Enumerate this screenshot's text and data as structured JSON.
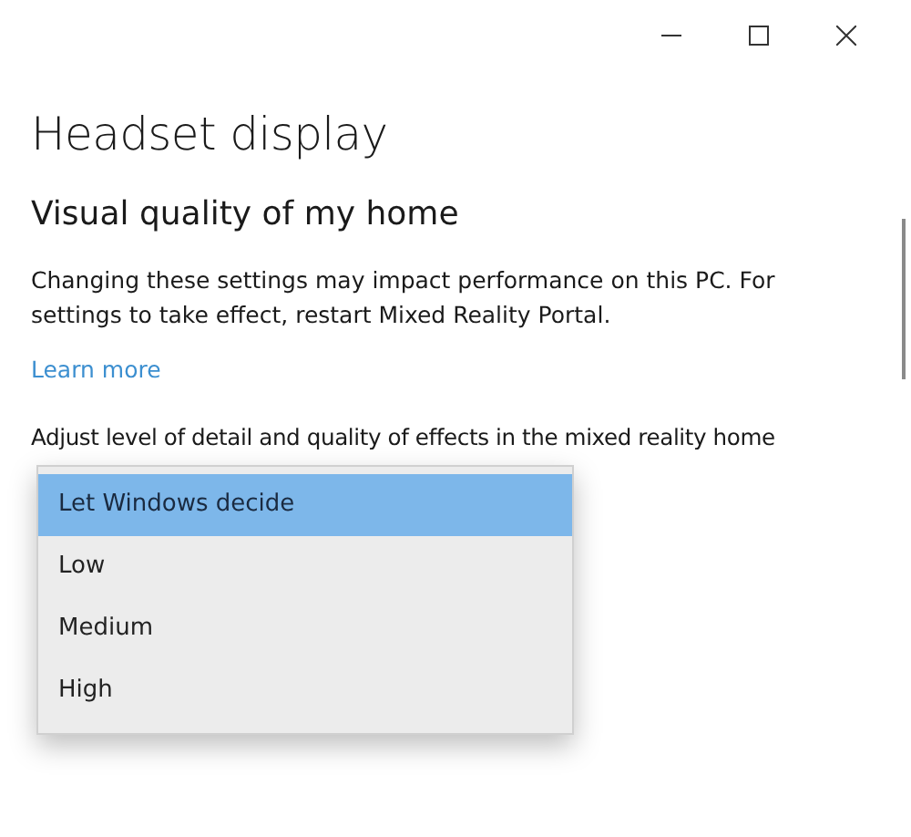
{
  "window": {
    "controls": [
      {
        "kind": "minimize"
      },
      {
        "kind": "maximize"
      },
      {
        "kind": "close"
      }
    ]
  },
  "title": "Headset display",
  "section": {
    "heading": "Visual quality of my home",
    "description": "Changing these settings may impact performance on this PC. For settings to take effect, restart Mixed Reality Portal.",
    "link": "Learn more",
    "label": "Adjust level of detail and quality of effects in the mixed reality home"
  },
  "dropdown": {
    "options": [
      {
        "label": "Let Windows decide",
        "selected": true
      },
      {
        "label": "Low",
        "selected": false
      },
      {
        "label": "Medium",
        "selected": false
      },
      {
        "label": "High",
        "selected": false
      }
    ]
  }
}
